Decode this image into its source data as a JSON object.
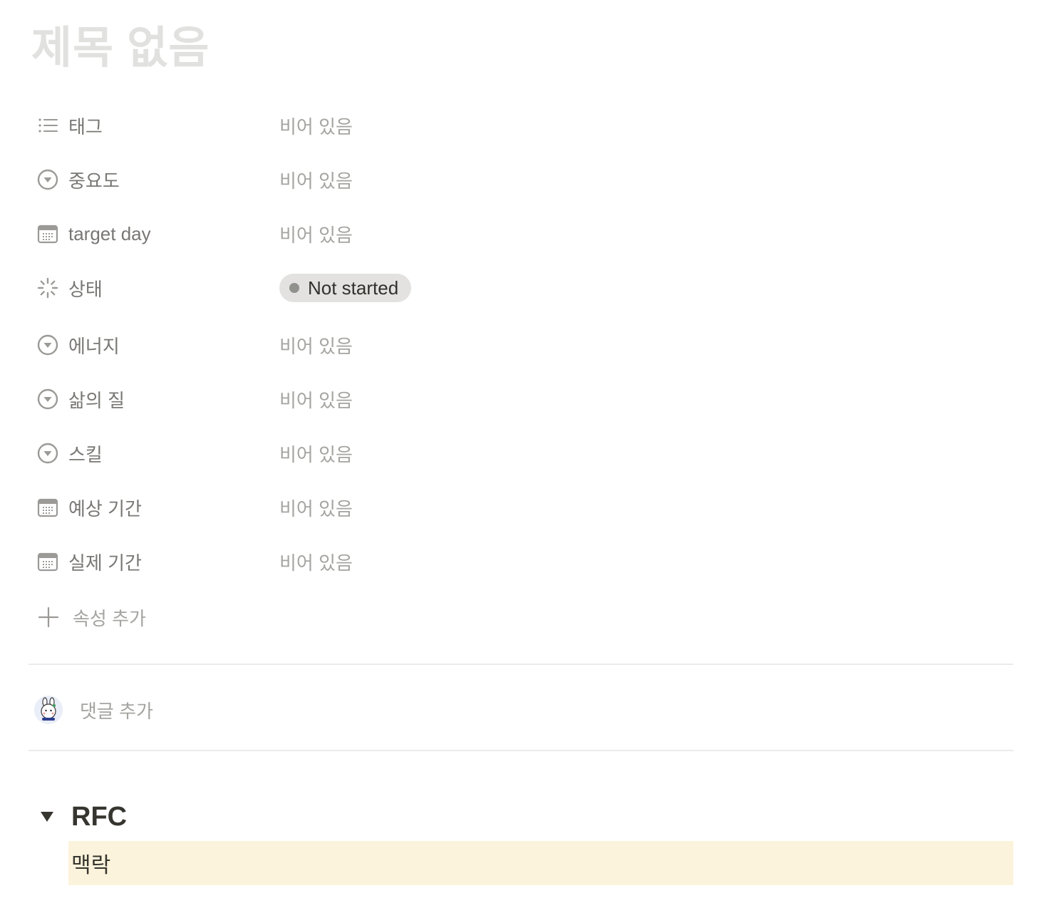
{
  "page": {
    "title": "제목 없음"
  },
  "properties": [
    {
      "icon": "list-icon",
      "label": "태그",
      "value": "비어 있음"
    },
    {
      "icon": "select-icon",
      "label": "중요도",
      "value": "비어 있음"
    },
    {
      "icon": "calendar-icon",
      "label": "target day",
      "value": "비어 있음"
    },
    {
      "icon": "status-icon",
      "label": "상태",
      "value": "Not started"
    },
    {
      "icon": "select-icon",
      "label": "에너지",
      "value": "비어 있음"
    },
    {
      "icon": "select-icon",
      "label": "삶의 질",
      "value": "비어 있음"
    },
    {
      "icon": "select-icon",
      "label": "스킬",
      "value": "비어 있음"
    },
    {
      "icon": "calendar-icon",
      "label": "예상 기간",
      "value": "비어 있음"
    },
    {
      "icon": "calendar-icon",
      "label": "실제 기간",
      "value": "비어 있음"
    }
  ],
  "add_property": {
    "label": "속성 추가"
  },
  "comments": {
    "placeholder": "댓글 추가"
  },
  "toggle": {
    "title": "RFC",
    "callout_text": "맥락"
  },
  "colors": {
    "title_placeholder": "#e1e1df",
    "label": "#787774",
    "empty_value": "#a4a4a0",
    "status_bg": "#e3e2e0",
    "status_dot": "#91918e",
    "callout_bg": "#fbf3db",
    "divider": "#ebebea"
  }
}
